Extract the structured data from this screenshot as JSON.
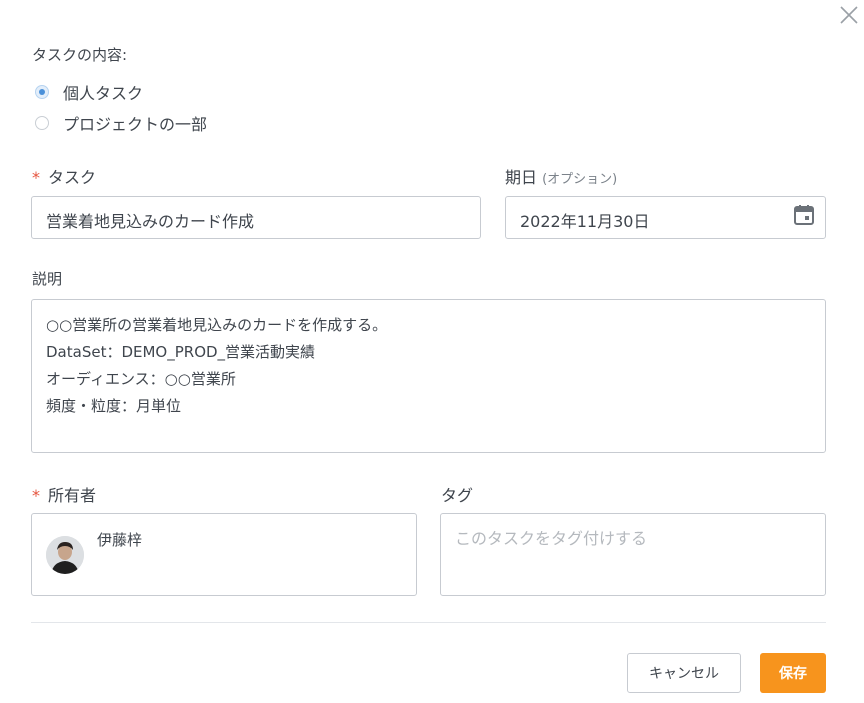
{
  "task_type": {
    "label": "タスクの内容:",
    "options": [
      {
        "label": "個人タスク",
        "checked": true
      },
      {
        "label": "プロジェクトの一部",
        "checked": false
      }
    ]
  },
  "task": {
    "required_mark": "*",
    "label": "タスク",
    "value": "営業着地見込みのカード作成"
  },
  "due_date": {
    "label": "期日",
    "hint": "(オプション)",
    "value": "2022年11月30日",
    "icon": "calendar-icon"
  },
  "description": {
    "label": "説明",
    "lines": [
      "○○営業所の営業着地見込みのカードを作成する。",
      "DataSet：DEMO_PROD_営業活動実績",
      "オーディエンス：○○営業所",
      "頻度・粒度：月単位"
    ]
  },
  "owner": {
    "required_mark": "*",
    "label": "所有者",
    "name": "伊藤梓"
  },
  "tags": {
    "label": "タグ",
    "placeholder": "このタスクをタグ付けする"
  },
  "footer": {
    "cancel_label": "キャンセル",
    "save_label": "保存"
  },
  "colors": {
    "accent": "#f7941d",
    "required": "#e5533d",
    "radio_selected": "#4a90d9"
  }
}
